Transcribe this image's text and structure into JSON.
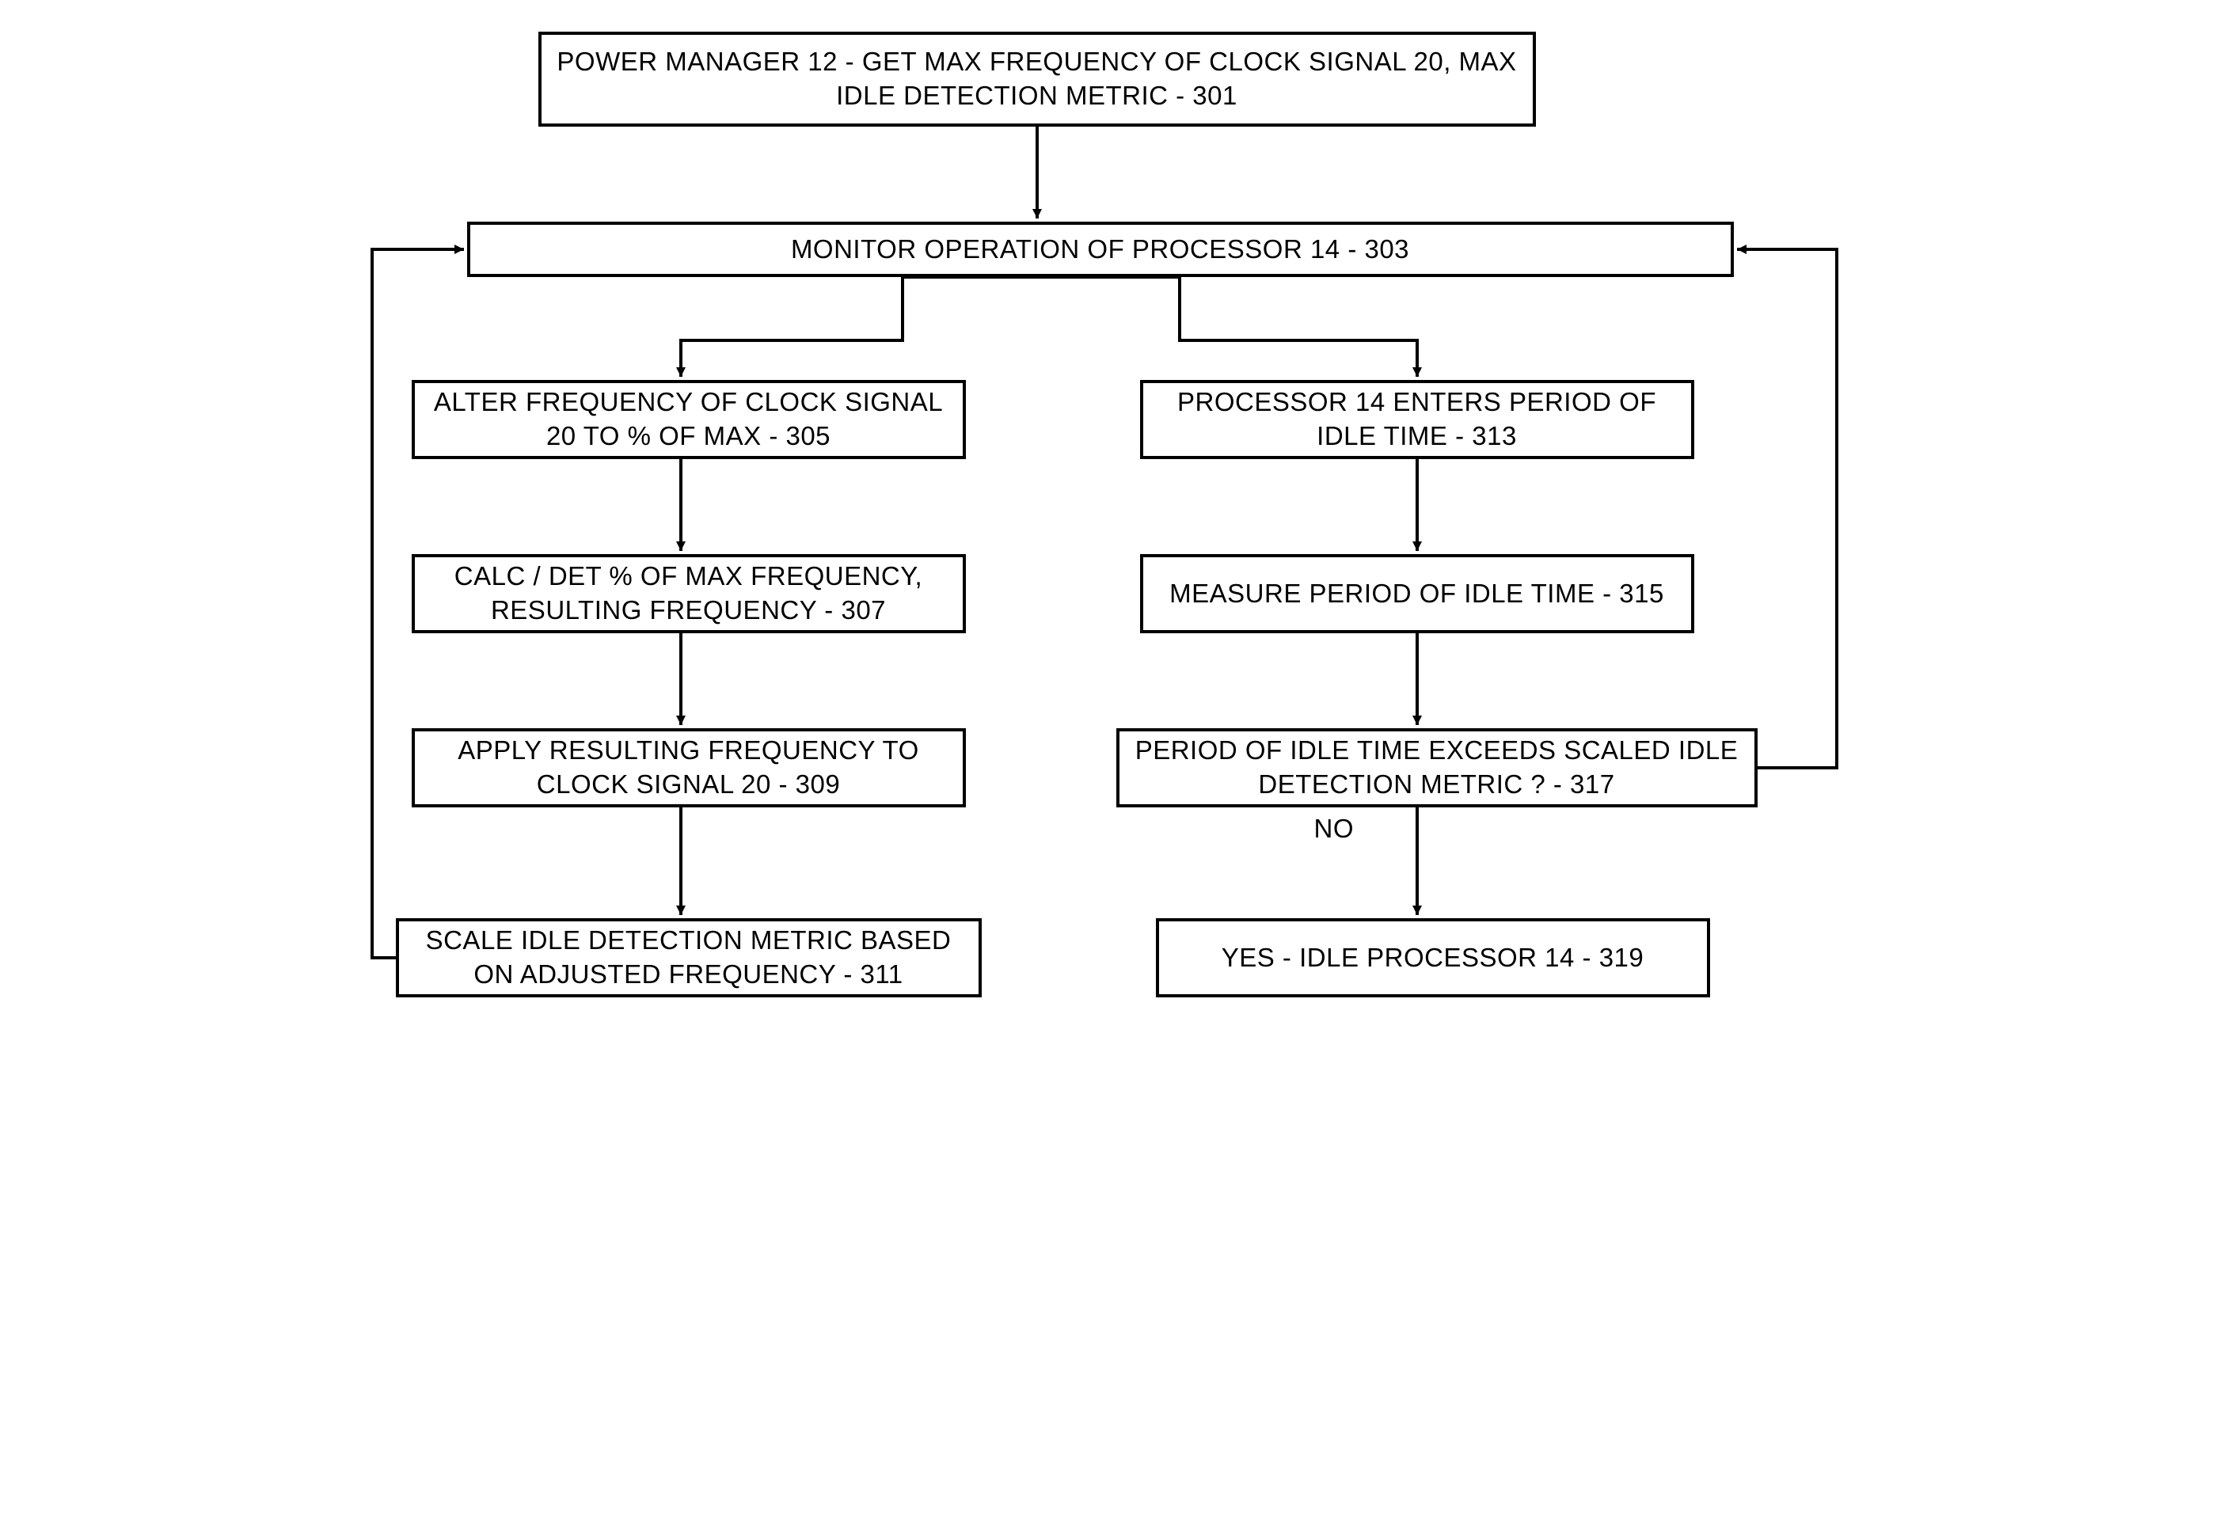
{
  "boxes": {
    "b301": "POWER MANAGER 12 - GET MAX FREQUENCY OF CLOCK SIGNAL 20, MAX IDLE DETECTION METRIC - 301",
    "b303": "MONITOR OPERATION OF PROCESSOR 14 - 303",
    "b305": "ALTER FREQUENCY OF CLOCK SIGNAL 20 TO % OF MAX - 305",
    "b307": "CALC / DET % OF MAX FREQUENCY, RESULTING FREQUENCY - 307",
    "b309": "APPLY RESULTING FREQUENCY TO CLOCK SIGNAL 20 - 309",
    "b311": "SCALE IDLE DETECTION METRIC BASED ON ADJUSTED FREQUENCY - 311",
    "b313": "PROCESSOR 14 ENTERS PERIOD OF IDLE TIME - 313",
    "b315": "MEASURE PERIOD OF IDLE TIME - 315",
    "b317": "PERIOD OF IDLE TIME EXCEEDS SCALED IDLE DETECTION METRIC ? - 317",
    "b319": "YES - IDLE PROCESSOR 14 - 319"
  },
  "labels": {
    "no": "NO"
  }
}
